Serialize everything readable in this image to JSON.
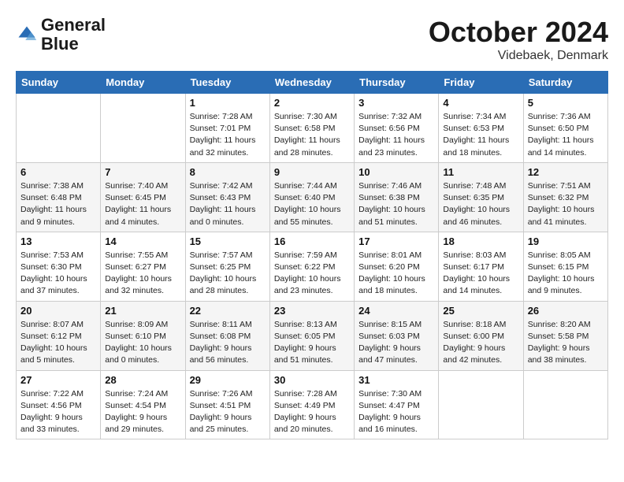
{
  "header": {
    "logo_line1": "General",
    "logo_line2": "Blue",
    "month": "October 2024",
    "location": "Videbaek, Denmark"
  },
  "weekdays": [
    "Sunday",
    "Monday",
    "Tuesday",
    "Wednesday",
    "Thursday",
    "Friday",
    "Saturday"
  ],
  "weeks": [
    [
      {
        "day": "",
        "info": ""
      },
      {
        "day": "",
        "info": ""
      },
      {
        "day": "1",
        "info": "Sunrise: 7:28 AM\nSunset: 7:01 PM\nDaylight: 11 hours and 32 minutes."
      },
      {
        "day": "2",
        "info": "Sunrise: 7:30 AM\nSunset: 6:58 PM\nDaylight: 11 hours and 28 minutes."
      },
      {
        "day": "3",
        "info": "Sunrise: 7:32 AM\nSunset: 6:56 PM\nDaylight: 11 hours and 23 minutes."
      },
      {
        "day": "4",
        "info": "Sunrise: 7:34 AM\nSunset: 6:53 PM\nDaylight: 11 hours and 18 minutes."
      },
      {
        "day": "5",
        "info": "Sunrise: 7:36 AM\nSunset: 6:50 PM\nDaylight: 11 hours and 14 minutes."
      }
    ],
    [
      {
        "day": "6",
        "info": "Sunrise: 7:38 AM\nSunset: 6:48 PM\nDaylight: 11 hours and 9 minutes."
      },
      {
        "day": "7",
        "info": "Sunrise: 7:40 AM\nSunset: 6:45 PM\nDaylight: 11 hours and 4 minutes."
      },
      {
        "day": "8",
        "info": "Sunrise: 7:42 AM\nSunset: 6:43 PM\nDaylight: 11 hours and 0 minutes."
      },
      {
        "day": "9",
        "info": "Sunrise: 7:44 AM\nSunset: 6:40 PM\nDaylight: 10 hours and 55 minutes."
      },
      {
        "day": "10",
        "info": "Sunrise: 7:46 AM\nSunset: 6:38 PM\nDaylight: 10 hours and 51 minutes."
      },
      {
        "day": "11",
        "info": "Sunrise: 7:48 AM\nSunset: 6:35 PM\nDaylight: 10 hours and 46 minutes."
      },
      {
        "day": "12",
        "info": "Sunrise: 7:51 AM\nSunset: 6:32 PM\nDaylight: 10 hours and 41 minutes."
      }
    ],
    [
      {
        "day": "13",
        "info": "Sunrise: 7:53 AM\nSunset: 6:30 PM\nDaylight: 10 hours and 37 minutes."
      },
      {
        "day": "14",
        "info": "Sunrise: 7:55 AM\nSunset: 6:27 PM\nDaylight: 10 hours and 32 minutes."
      },
      {
        "day": "15",
        "info": "Sunrise: 7:57 AM\nSunset: 6:25 PM\nDaylight: 10 hours and 28 minutes."
      },
      {
        "day": "16",
        "info": "Sunrise: 7:59 AM\nSunset: 6:22 PM\nDaylight: 10 hours and 23 minutes."
      },
      {
        "day": "17",
        "info": "Sunrise: 8:01 AM\nSunset: 6:20 PM\nDaylight: 10 hours and 18 minutes."
      },
      {
        "day": "18",
        "info": "Sunrise: 8:03 AM\nSunset: 6:17 PM\nDaylight: 10 hours and 14 minutes."
      },
      {
        "day": "19",
        "info": "Sunrise: 8:05 AM\nSunset: 6:15 PM\nDaylight: 10 hours and 9 minutes."
      }
    ],
    [
      {
        "day": "20",
        "info": "Sunrise: 8:07 AM\nSunset: 6:12 PM\nDaylight: 10 hours and 5 minutes."
      },
      {
        "day": "21",
        "info": "Sunrise: 8:09 AM\nSunset: 6:10 PM\nDaylight: 10 hours and 0 minutes."
      },
      {
        "day": "22",
        "info": "Sunrise: 8:11 AM\nSunset: 6:08 PM\nDaylight: 9 hours and 56 minutes."
      },
      {
        "day": "23",
        "info": "Sunrise: 8:13 AM\nSunset: 6:05 PM\nDaylight: 9 hours and 51 minutes."
      },
      {
        "day": "24",
        "info": "Sunrise: 8:15 AM\nSunset: 6:03 PM\nDaylight: 9 hours and 47 minutes."
      },
      {
        "day": "25",
        "info": "Sunrise: 8:18 AM\nSunset: 6:00 PM\nDaylight: 9 hours and 42 minutes."
      },
      {
        "day": "26",
        "info": "Sunrise: 8:20 AM\nSunset: 5:58 PM\nDaylight: 9 hours and 38 minutes."
      }
    ],
    [
      {
        "day": "27",
        "info": "Sunrise: 7:22 AM\nSunset: 4:56 PM\nDaylight: 9 hours and 33 minutes."
      },
      {
        "day": "28",
        "info": "Sunrise: 7:24 AM\nSunset: 4:54 PM\nDaylight: 9 hours and 29 minutes."
      },
      {
        "day": "29",
        "info": "Sunrise: 7:26 AM\nSunset: 4:51 PM\nDaylight: 9 hours and 25 minutes."
      },
      {
        "day": "30",
        "info": "Sunrise: 7:28 AM\nSunset: 4:49 PM\nDaylight: 9 hours and 20 minutes."
      },
      {
        "day": "31",
        "info": "Sunrise: 7:30 AM\nSunset: 4:47 PM\nDaylight: 9 hours and 16 minutes."
      },
      {
        "day": "",
        "info": ""
      },
      {
        "day": "",
        "info": ""
      }
    ]
  ]
}
